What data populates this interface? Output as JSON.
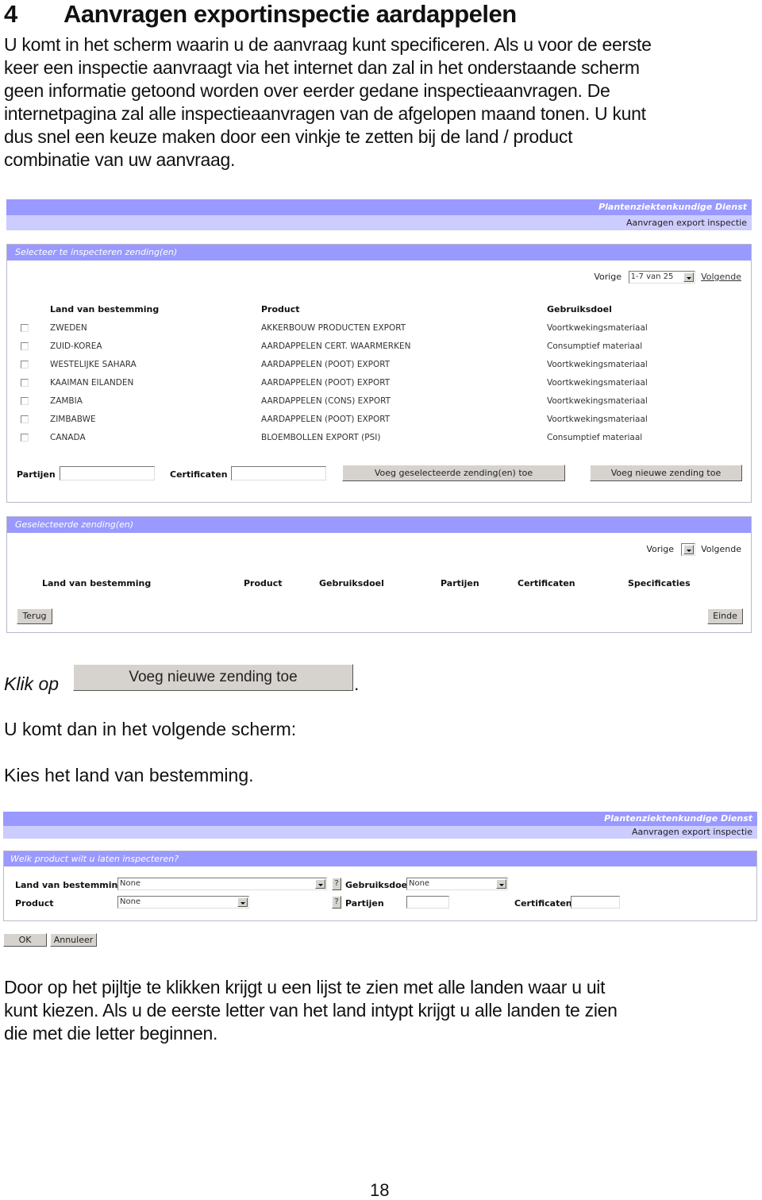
{
  "heading": {
    "number": "4",
    "title": "Aanvragen exportinspectie aardappelen"
  },
  "intro_lines": [
    "U komt in het scherm waarin u de aanvraag kunt specificeren. Als u voor de eerste",
    "keer een inspectie aanvraagt via het internet dan zal in het onderstaande scherm",
    "geen informatie getoond worden over eerder gedane inspectieaanvragen. De",
    "internetpagina zal alle inspectieaanvragen van de afgelopen maand tonen. U kunt",
    "dus snel een keuze maken door een vinkje te zetten bij de land / product",
    "combinatie van uw aanvraag."
  ],
  "screen1": {
    "org_name": "Plantenziektenkundige Dienst",
    "app_title": "Aanvragen export inspectie",
    "select_panel": {
      "title": "Selecteer te inspecteren zending(en)",
      "pager": {
        "prev": "Vorige",
        "range": "1-7 van 25",
        "next": "Volgende"
      },
      "headers": {
        "country": "Land van bestemming",
        "product": "Product",
        "purpose": "Gebruiksdoel"
      },
      "rows": [
        {
          "country": "ZWEDEN",
          "product": "AKKERBOUW PRODUCTEN EXPORT",
          "purpose": "Voortkwekingsmateriaal",
          "checked": false
        },
        {
          "country": "ZUID-KOREA",
          "product": "AARDAPPELEN CERT. WAARMERKEN",
          "purpose": "Consumptief materiaal",
          "checked": false
        },
        {
          "country": "WESTELIJKE SAHARA",
          "product": "AARDAPPELEN (POOT) EXPORT",
          "purpose": "Voortkwekingsmateriaal",
          "checked": false
        },
        {
          "country": "KAAIMAN EILANDEN",
          "product": "AARDAPPELEN (POOT) EXPORT",
          "purpose": "Voortkwekingsmateriaal",
          "checked": false
        },
        {
          "country": "ZAMBIA",
          "product": "AARDAPPELEN (CONS) EXPORT",
          "purpose": "Voortkwekingsmateriaal",
          "checked": false
        },
        {
          "country": "ZIMBABWE",
          "product": "AARDAPPELEN (POOT) EXPORT",
          "purpose": "Voortkwekingsmateriaal",
          "checked": false
        },
        {
          "country": "CANADA",
          "product": "BLOEMBOLLEN EXPORT (PSI)",
          "purpose": "Consumptief materiaal",
          "checked": false
        }
      ],
      "partijen_label": "Partijen",
      "partijen_value": "",
      "certificaten_label": "Certificaten",
      "certificaten_value": "",
      "add_selected_button": "Voeg geselecteerde zending(en) toe",
      "add_new_button": "Voeg nieuwe zending toe"
    },
    "selected_panel": {
      "title": "Geselecteerde zending(en)",
      "pager": {
        "prev": "Vorige",
        "range": "",
        "next": "Volgende"
      },
      "headers": [
        "Land van bestemming",
        "Product",
        "Gebruiksdoel",
        "Partijen",
        "Certificaten",
        "Specificaties"
      ],
      "back_button": "Terug",
      "end_button": "Einde"
    }
  },
  "click_instruction": {
    "prefix": "Klik op",
    "button": "Voeg nieuwe zending toe",
    "suffix": "."
  },
  "next_screen_text": "U komt dan in het volgende scherm:",
  "choose_country_text": "Kies het land van bestemming.",
  "screen2": {
    "org_name": "Plantenziektenkundige Dienst",
    "app_title": "Aanvragen export inspectie",
    "panel_title": "Welk product wilt u laten inspecteren?",
    "country_label": "Land van bestemming",
    "country_value": "None",
    "product_label": "Product",
    "product_value": "None",
    "help_label": "?",
    "purpose_label": "Gebruiksdoel",
    "purpose_value": "None",
    "partijen_label": "Partijen",
    "partijen_value": "",
    "certificaten_label": "Certificaten",
    "certificaten_value": "",
    "ok_button": "OK",
    "cancel_button": "Annuleer"
  },
  "outro_lines": [
    "Door op het pijltje te klikken krijgt u een lijst te zien met alle landen waar u uit",
    "kunt kiezen. Als u de eerste letter van het land intypt krijgt u alle landen te zien",
    "die met die letter beginnen."
  ],
  "page_number": "18"
}
